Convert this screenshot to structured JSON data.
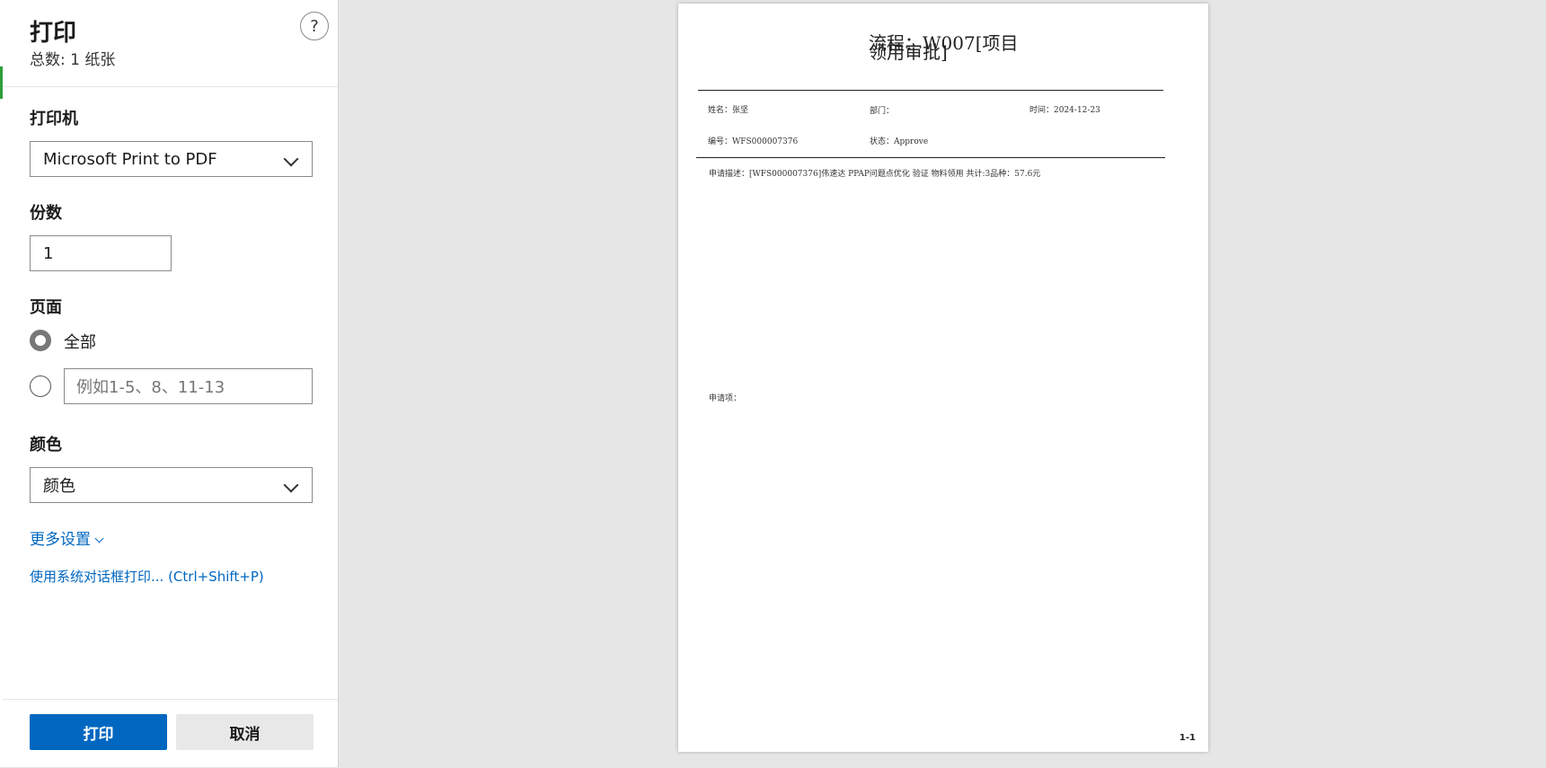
{
  "panel": {
    "title": "打印",
    "subtitle": "总数: 1 纸张",
    "help_label": "?",
    "printer": {
      "label": "打印机",
      "value": "Microsoft Print to PDF"
    },
    "copies": {
      "label": "份数",
      "value": "1"
    },
    "pages": {
      "label": "页面",
      "option_all": "全部",
      "range_placeholder": "例如1-5、8、11-13"
    },
    "color": {
      "label": "颜色",
      "value": "颜色"
    },
    "more_settings": "更多设置",
    "system_dialog": "使用系统对话框打印... (Ctrl+Shift+P)",
    "print_button": "打印",
    "cancel_button": "取消"
  },
  "preview": {
    "title_line1": "流程：W007[项目",
    "title_line2": "领用审批]",
    "name": "姓名：张坚",
    "department": "部门：",
    "time": "时间：2024-12-23",
    "number": "编号：WFS000007376",
    "status": "状态：Approve",
    "description": "申请描述：[WFS000007376]伟速达 PPAP问题点优化 验证 物料领用 共计:3品种：57.6元",
    "items_label": "申请项：",
    "page_number": "1-1"
  },
  "colors": {
    "accent": "#0067c0",
    "primary_button": "#0067c0",
    "cancel_button": "#e8e8e8"
  }
}
